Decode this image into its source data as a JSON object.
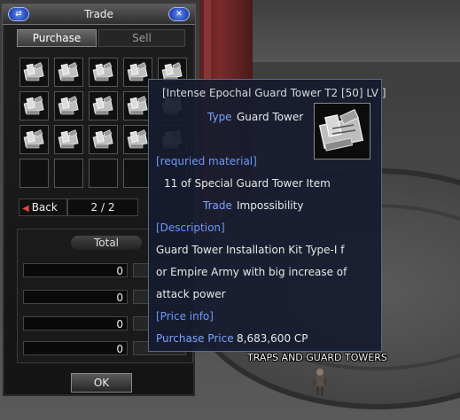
{
  "window": {
    "title": "Trade",
    "tabs": [
      {
        "label": "Purchase",
        "active": true
      },
      {
        "label": "Sell",
        "active": false
      }
    ],
    "items": [
      {
        "icon": "guard-tower-kit-icon"
      },
      {
        "icon": "guard-tower-kit-icon"
      },
      {
        "icon": "guard-tower-kit-icon"
      },
      {
        "icon": "guard-tower-kit-icon"
      },
      {
        "icon": "guard-tower-kit-icon"
      },
      {
        "icon": "guard-tower-kit-icon"
      },
      {
        "icon": "guard-tower-kit-icon"
      },
      {
        "icon": "guard-tower-kit-icon"
      },
      {
        "icon": "guard-tower-kit-icon"
      },
      {
        "icon": "guard-tower-kit-icon"
      },
      {
        "icon": "guard-tower-kit-icon"
      },
      {
        "icon": "guard-tower-kit-icon"
      },
      {
        "icon": "guard-tower-kit-icon"
      },
      {
        "icon": "guard-tower-kit-icon"
      },
      {
        "icon": "guard-tower-kit-icon"
      },
      {
        "icon": ""
      },
      {
        "icon": ""
      },
      {
        "icon": ""
      },
      {
        "icon": ""
      },
      {
        "icon": ""
      }
    ],
    "back_label": "Back",
    "page": "2 / 2",
    "total_label": "Total",
    "amounts": [
      "0",
      "0",
      "0",
      "0"
    ],
    "ok_label": "OK"
  },
  "tooltip": {
    "name": "[Intense Epochal Guard Tower T2 [50] LV ]",
    "type_key": "Type",
    "type_val": "Guard Tower",
    "material_header": "[requried material]",
    "material_val": "11 of Special Guard Tower Item",
    "trade_key": "Trade",
    "trade_val": "Impossibility",
    "description_header": "[Description]",
    "description_lines": [
      "Guard Tower Installation Kit Type-I f",
      "or Empire Army with big increase of",
      "attack power"
    ],
    "price_header": "[Price info]",
    "price_key": "Purchase Price",
    "price_val": "8,683,600 CP"
  },
  "world": {
    "label": "TRAPS AND GUARD TOWERS"
  },
  "colors": {
    "accent_blue": "#7aa2ff",
    "tooltip_bg": "#161c2e",
    "title_button": "#2347b8"
  }
}
